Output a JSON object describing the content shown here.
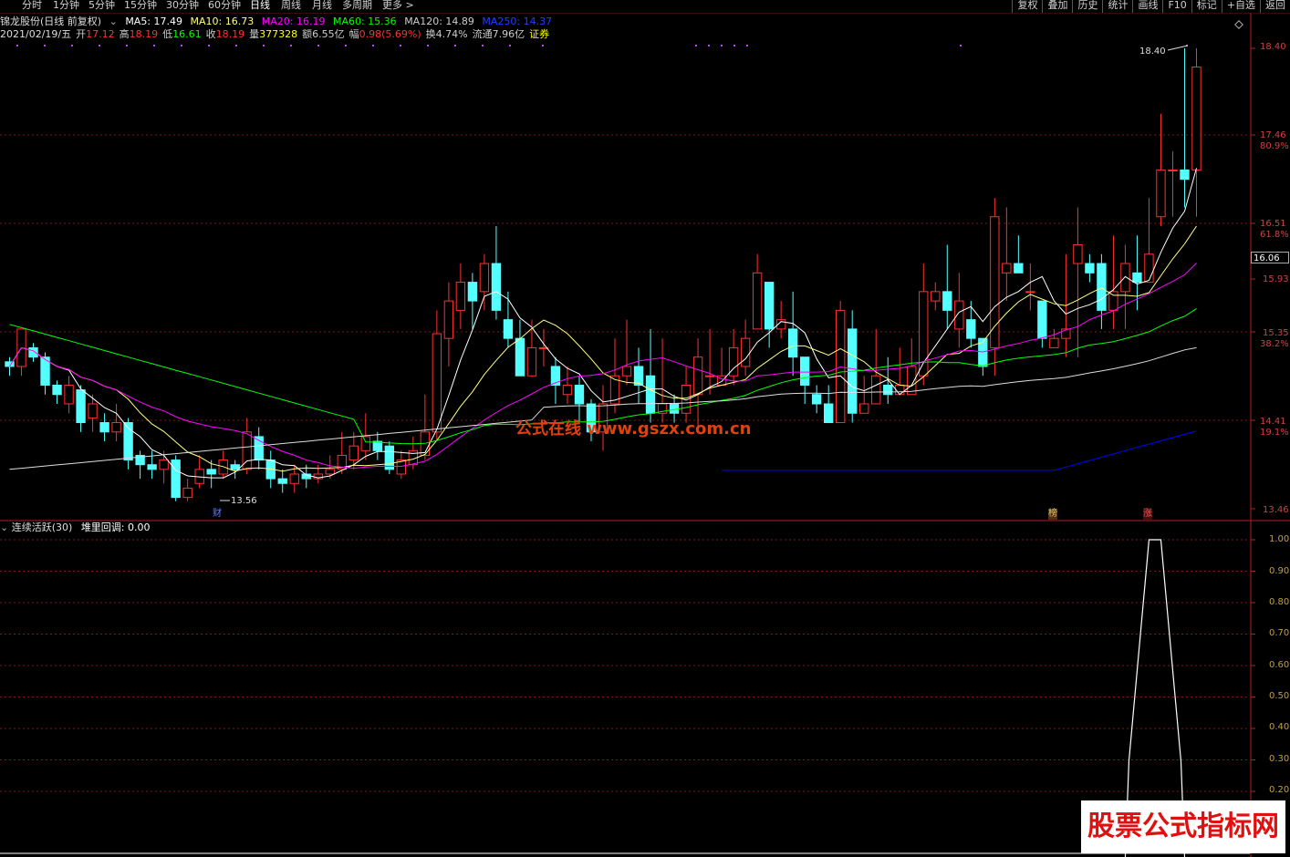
{
  "tabs": [
    {
      "label": "分时",
      "active": false
    },
    {
      "label": "1分钟",
      "active": false
    },
    {
      "label": "5分钟",
      "active": false
    },
    {
      "label": "15分钟",
      "active": false
    },
    {
      "label": "30分钟",
      "active": false
    },
    {
      "label": "60分钟",
      "active": false
    },
    {
      "label": "日线",
      "active": true
    },
    {
      "label": "周线",
      "active": false
    },
    {
      "label": "月线",
      "active": false
    },
    {
      "label": "多周期",
      "active": false
    },
    {
      "label": "更多 >",
      "active": false
    }
  ],
  "right_buttons": [
    "复权",
    "叠加",
    "历史",
    "统计",
    "画线",
    "F10",
    "标记",
    "+自选",
    "返回"
  ],
  "header": {
    "stock_title": "锦龙股份(日线 前复权)",
    "ma": [
      {
        "label": "MA5: 17.49",
        "color": "#ffffff"
      },
      {
        "label": "MA10: 16.73",
        "color": "#ffff00"
      },
      {
        "label": "MA20: 16.19",
        "color": "#ff00ff"
      },
      {
        "label": "MA60: 15.36",
        "color": "#00ff00"
      },
      {
        "label": "MA120: 14.89",
        "color": "#cccccc"
      },
      {
        "label": "MA250: 14.37",
        "color": "#0000ff"
      }
    ],
    "date": "2021/02/19/五",
    "quote": [
      {
        "label": "开",
        "value": "17.12",
        "color": "#ff3030"
      },
      {
        "label": "高",
        "value": "18.19",
        "color": "#ff3030"
      },
      {
        "label": "低",
        "value": "16.61",
        "color": "#00ff00"
      },
      {
        "label": "收",
        "value": "18.19",
        "color": "#ff3030"
      },
      {
        "label": "量",
        "value": "377328",
        "color": "#ffff00"
      },
      {
        "label": "额",
        "value": "6.55亿",
        "color": "#cccccc"
      },
      {
        "label": "幅",
        "value": "0.98(5.69%)",
        "color": "#ff3030"
      },
      {
        "label": "换",
        "value": "4.74%",
        "color": "#cccccc"
      },
      {
        "label": "流通",
        "value": "7.96亿",
        "color": "#cccccc"
      },
      {
        "label": "",
        "value": "证券",
        "color": "#ffff00"
      }
    ]
  },
  "y_axis_main": [
    "18.40",
    "17.46",
    "16.51",
    "15.93",
    "15.35",
    "14.41",
    "13.46"
  ],
  "y_axis_pct": [
    "80.9%",
    "61.8%",
    "38.2%",
    "19.1%"
  ],
  "current_price": "16.06",
  "annotations": {
    "high": "18.40",
    "low": "13.56",
    "cai": "财",
    "bang": "榜",
    "zhang": "涨"
  },
  "watermark": "公式在线 www.gszx.com.cn",
  "sub": {
    "indicator": "连续活跃(30)",
    "value_label": "堆里回调: 0.00"
  },
  "y_axis_sub": [
    "1.00",
    "0.90",
    "0.80",
    "0.70",
    "0.60",
    "0.50",
    "0.40",
    "0.30",
    "0.20"
  ],
  "brand": "股票公式指标网",
  "colors": {
    "up": "#ff3030",
    "down": "#54ffff",
    "ma5": "#ffffff",
    "ma10": "#ffff80",
    "ma20": "#ff00ff",
    "ma60": "#00ff00",
    "ma120": "#dddddd",
    "ma250": "#0000ff"
  },
  "chart_data": {
    "type": "candlestick",
    "candles": [
      [
        15.05,
        15.0,
        14.9,
        15.1
      ],
      [
        15.0,
        15.4,
        15.3,
        14.9
      ],
      [
        15.2,
        15.1,
        15.25,
        15.05
      ],
      [
        15.1,
        14.8,
        15.15,
        14.7
      ],
      [
        14.8,
        14.7,
        14.85,
        14.6
      ],
      [
        14.6,
        14.8,
        14.9,
        14.5
      ],
      [
        14.75,
        14.4,
        14.8,
        14.3
      ],
      [
        14.45,
        14.6,
        14.7,
        14.3
      ],
      [
        14.4,
        14.3,
        14.5,
        14.2
      ],
      [
        14.3,
        14.4,
        14.6,
        14.2
      ],
      [
        14.4,
        14.0,
        14.45,
        13.9
      ],
      [
        14.05,
        13.95,
        14.1,
        13.8
      ],
      [
        13.95,
        13.9,
        14.1,
        13.8
      ],
      [
        13.9,
        14.0,
        14.1,
        13.75
      ],
      [
        14.0,
        13.6,
        14.05,
        13.56
      ],
      [
        13.6,
        13.7,
        13.8,
        13.56
      ],
      [
        13.75,
        13.9,
        14.05,
        13.7
      ],
      [
        13.9,
        13.85,
        14.0,
        13.7
      ],
      [
        13.85,
        14.0,
        14.1,
        13.8
      ],
      [
        13.95,
        13.9,
        14.0,
        13.8
      ],
      [
        13.9,
        14.3,
        14.45,
        13.85
      ],
      [
        14.25,
        14.0,
        14.35,
        13.9
      ],
      [
        14.0,
        13.8,
        14.1,
        13.7
      ],
      [
        13.8,
        13.75,
        13.9,
        13.65
      ],
      [
        13.75,
        13.85,
        13.95,
        13.65
      ],
      [
        13.85,
        13.8,
        13.95,
        13.7
      ],
      [
        13.8,
        13.85,
        13.95,
        13.75
      ],
      [
        13.85,
        13.9,
        14.05,
        13.8
      ],
      [
        13.9,
        14.05,
        14.3,
        13.85
      ],
      [
        14.0,
        14.15,
        14.3,
        13.9
      ],
      [
        14.1,
        14.25,
        14.5,
        14.0
      ],
      [
        14.2,
        14.1,
        14.3,
        14.0
      ],
      [
        14.15,
        13.9,
        14.2,
        13.85
      ],
      [
        13.85,
        14.0,
        14.1,
        13.8
      ],
      [
        13.95,
        14.1,
        14.25,
        13.9
      ],
      [
        14.05,
        14.3,
        14.7,
        14.0
      ],
      [
        14.3,
        15.35,
        15.6,
        14.2
      ],
      [
        15.3,
        15.7,
        15.9,
        15.0
      ],
      [
        15.6,
        15.9,
        16.1,
        15.4
      ],
      [
        15.9,
        15.7,
        16.0,
        15.4
      ],
      [
        15.8,
        16.1,
        16.2,
        15.6
      ],
      [
        16.1,
        15.6,
        16.5,
        15.5
      ],
      [
        15.5,
        15.3,
        15.8,
        15.2
      ],
      [
        15.3,
        14.9,
        15.5,
        14.9
      ],
      [
        14.9,
        15.2,
        15.5,
        14.9
      ],
      [
        15.2,
        15.2,
        15.4,
        15.0
      ],
      [
        15.0,
        14.8,
        15.1,
        14.6
      ],
      [
        14.7,
        14.8,
        15.0,
        14.6
      ],
      [
        14.8,
        14.6,
        14.9,
        14.4
      ],
      [
        14.6,
        14.3,
        14.65,
        14.2
      ],
      [
        14.3,
        14.6,
        14.8,
        14.1
      ],
      [
        14.6,
        14.9,
        15.3,
        14.5
      ],
      [
        14.9,
        15.0,
        15.5,
        14.8
      ],
      [
        15.0,
        14.8,
        15.2,
        14.6
      ],
      [
        14.9,
        14.5,
        15.4,
        14.4
      ],
      [
        14.5,
        14.6,
        15.3,
        14.4
      ],
      [
        14.6,
        14.5,
        14.7,
        14.4
      ],
      [
        14.5,
        14.8,
        15.0,
        14.4
      ],
      [
        14.7,
        15.1,
        15.3,
        14.3
      ],
      [
        14.9,
        14.9,
        15.4,
        14.7
      ],
      [
        14.8,
        14.9,
        15.2,
        14.8
      ],
      [
        14.9,
        15.2,
        15.4,
        14.8
      ],
      [
        15.0,
        15.3,
        15.5,
        14.9
      ],
      [
        15.4,
        16.0,
        16.2,
        15.4
      ],
      [
        15.9,
        15.4,
        15.9,
        15.2
      ],
      [
        15.4,
        15.5,
        15.7,
        15.3
      ],
      [
        15.4,
        15.1,
        15.8,
        14.9
      ],
      [
        15.1,
        14.8,
        15.1,
        14.6
      ],
      [
        14.7,
        14.6,
        14.8,
        14.5
      ],
      [
        14.6,
        14.4,
        14.8,
        14.4
      ],
      [
        14.4,
        15.6,
        15.7,
        14.4
      ],
      [
        15.4,
        14.5,
        15.6,
        14.4
      ],
      [
        14.5,
        14.6,
        14.9,
        14.5
      ],
      [
        14.6,
        14.9,
        15.4,
        14.6
      ],
      [
        14.8,
        14.7,
        15.1,
        14.6
      ],
      [
        14.7,
        14.8,
        15.2,
        14.7
      ],
      [
        14.7,
        15.0,
        15.3,
        14.7
      ],
      [
        14.9,
        15.8,
        16.1,
        14.8
      ],
      [
        15.7,
        15.8,
        15.9,
        15.6
      ],
      [
        15.8,
        15.6,
        16.3,
        15.4
      ],
      [
        15.4,
        15.7,
        16.0,
        15.2
      ],
      [
        15.5,
        15.3,
        15.7,
        15.2
      ],
      [
        15.3,
        15.0,
        15.3,
        14.9
      ],
      [
        15.2,
        16.6,
        16.8,
        14.9
      ],
      [
        16.0,
        16.1,
        16.7,
        15.7
      ],
      [
        16.1,
        16.0,
        16.4,
        16.0
      ],
      [
        15.8,
        15.8,
        16.1,
        15.6
      ],
      [
        15.7,
        15.3,
        15.7,
        15.2
      ],
      [
        15.2,
        15.3,
        15.4,
        15.2
      ],
      [
        15.3,
        15.4,
        16.2,
        15.1
      ],
      [
        16.1,
        16.3,
        16.7,
        15.1
      ],
      [
        16.1,
        16.0,
        16.2,
        15.9
      ],
      [
        16.1,
        15.6,
        16.2,
        15.4
      ],
      [
        15.6,
        15.8,
        16.4,
        15.4
      ],
      [
        15.8,
        16.1,
        16.3,
        15.4
      ],
      [
        16.0,
        15.9,
        16.4,
        15.6
      ],
      [
        15.9,
        16.2,
        16.8,
        15.9
      ],
      [
        16.6,
        17.1,
        17.7,
        16.5
      ],
      [
        17.1,
        17.1,
        17.3,
        16.6
      ],
      [
        17.1,
        17.0,
        18.4,
        16.7
      ],
      [
        17.1,
        18.2,
        18.4,
        16.6
      ]
    ],
    "ylim": [
      13.46,
      18.4
    ],
    "sub_series": {
      "name": "堆里回调",
      "values_tail": [
        0,
        0,
        1,
        1,
        0,
        0
      ]
    }
  }
}
